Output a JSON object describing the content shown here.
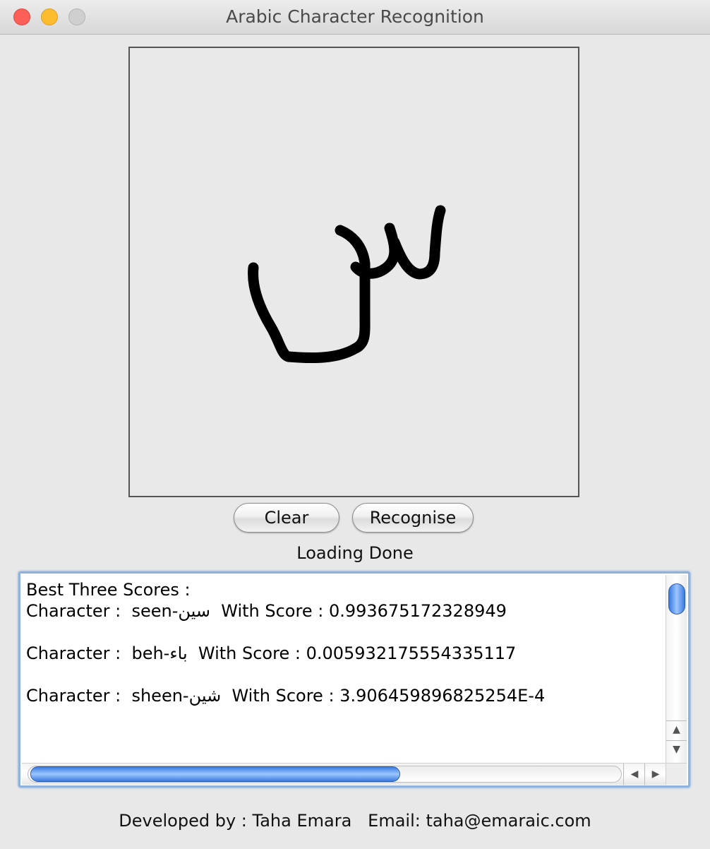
{
  "window": {
    "title": "Arabic Character Recognition"
  },
  "buttons": {
    "clear_label": "Clear",
    "recognise_label": "Recognise"
  },
  "status": "Loading Done",
  "results": {
    "heading": "Best Three Scores :",
    "items": [
      {
        "prefix": "Character :  ",
        "name": "seen-سين",
        "score_label": "  With Score : ",
        "score": "0.993675172328949"
      },
      {
        "prefix": "Character :  ",
        "name": "beh-باء",
        "score_label": "  With Score : ",
        "score": "0.005932175554335117"
      },
      {
        "prefix": "Character :  ",
        "name": "sheen-شين",
        "score_label": "  With Score : ",
        "score": "3.906459896825254E-4"
      }
    ]
  },
  "footer": {
    "developer": "Developed by : Taha Emara",
    "email": "Email: taha@emaraic.com"
  },
  "colors": {
    "close": "#fc5f57",
    "minimize": "#fdbc2e",
    "zoom": "#cfcfcf",
    "scroll_accent": "#3a7be0",
    "stroke": "#000000"
  }
}
